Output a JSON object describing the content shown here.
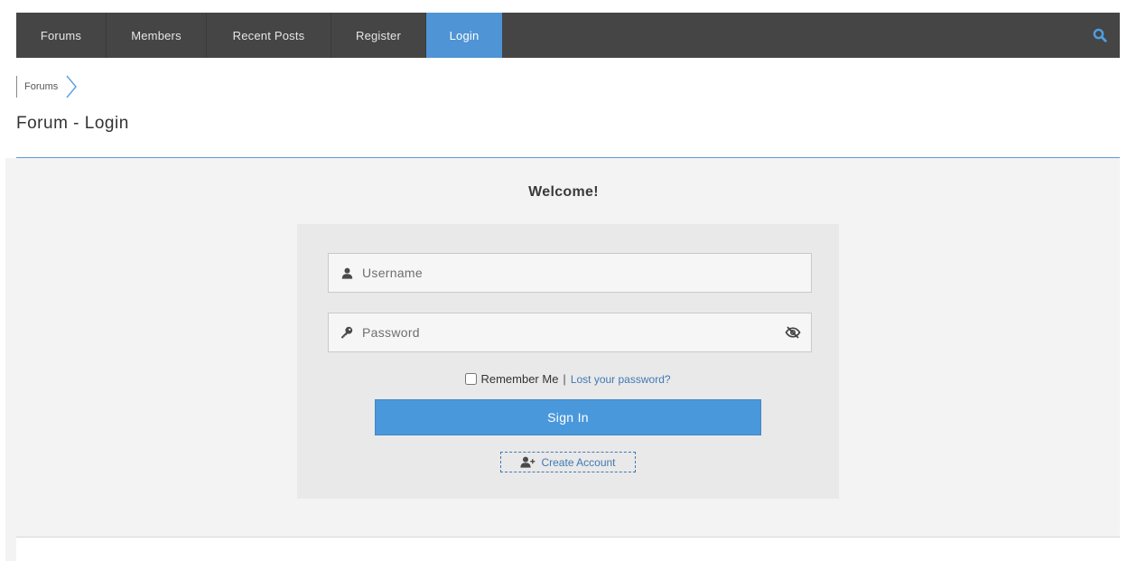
{
  "nav": {
    "items": [
      {
        "label": "Forums"
      },
      {
        "label": "Members"
      },
      {
        "label": "Recent Posts"
      },
      {
        "label": "Register"
      },
      {
        "label": "Login",
        "active": true
      }
    ],
    "search_icon": "search-icon",
    "active_color": "#4f94d4",
    "bar_color": "#454545"
  },
  "breadcrumb": {
    "items": [
      "Forums"
    ]
  },
  "page": {
    "title": "Forum - Login"
  },
  "login": {
    "welcome": "Welcome!",
    "username_placeholder": "Username",
    "password_placeholder": "Password",
    "remember_label": "Remember Me",
    "separator": "|",
    "lost_password": "Lost your password?",
    "sign_in": "Sign In",
    "create_account": "Create Account",
    "remember_checked": false
  },
  "colors": {
    "accent": "#4a98dc",
    "link": "#3f79b5"
  }
}
